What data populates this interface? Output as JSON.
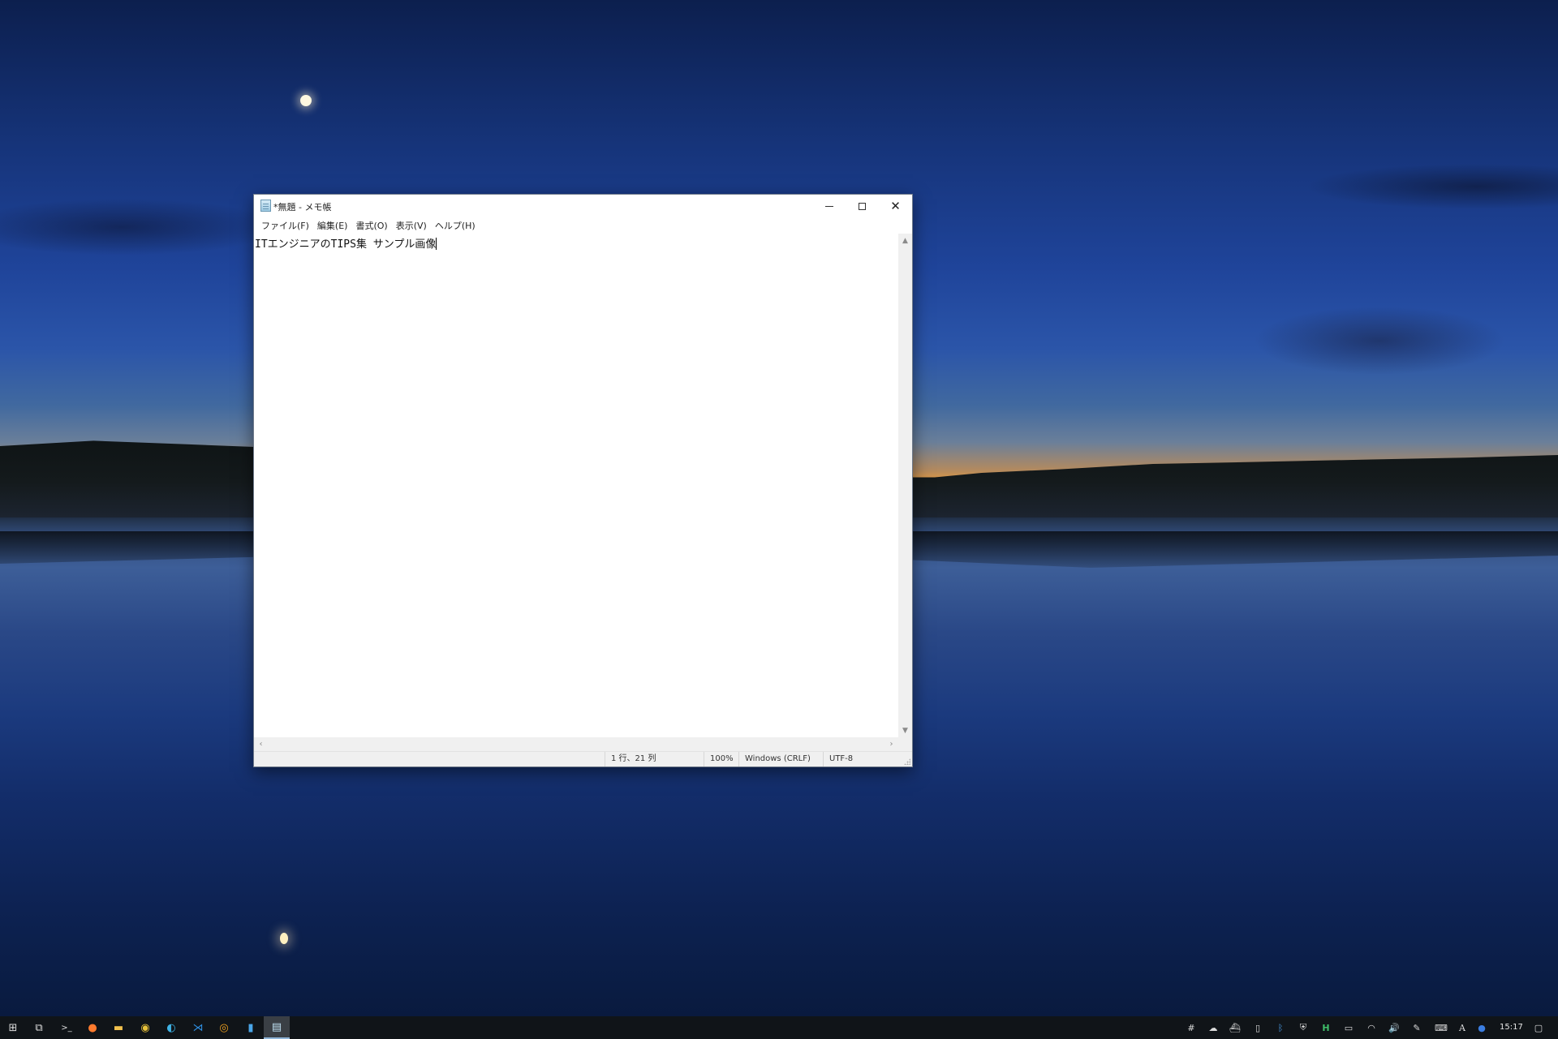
{
  "window": {
    "title": "*無題 - メモ帳",
    "close_glyph": "✕"
  },
  "menu": {
    "items": [
      {
        "label": "ファイル(F)"
      },
      {
        "label": "編集(E)"
      },
      {
        "label": "書式(O)"
      },
      {
        "label": "表示(V)"
      },
      {
        "label": "ヘルプ(H)"
      }
    ]
  },
  "editor": {
    "content": "ITエンジニアのTIPS集 サンプル画像"
  },
  "scrollbars": {
    "up_arrow": "▲",
    "down_arrow": "▼",
    "left_arrow": "‹",
    "right_arrow": "›"
  },
  "status": {
    "position": "1 行、21 列",
    "zoom": "100%",
    "line_ending": "Windows (CRLF)",
    "encoding": "UTF-8"
  },
  "taskbar": {
    "start_glyph": "⊞",
    "task_view_glyph": "⧉",
    "terminal_glyph": ">_",
    "firefox_glyph": "●",
    "explorer_glyph": "▬",
    "chrome_glyph": "◉",
    "edge_glyph": "◐",
    "vscode_glyph": "⋊",
    "app_glyph": "◎",
    "notes_glyph": "▮",
    "notepad_glyph": "▤"
  },
  "tray": {
    "icons": [
      {
        "name": "slack-icon",
        "glyph": "#"
      },
      {
        "name": "onedrive-icon",
        "glyph": "☁"
      },
      {
        "name": "docker-icon",
        "glyph": "⛴"
      },
      {
        "name": "usb-icon",
        "glyph": "▯"
      },
      {
        "name": "bluetooth-icon",
        "glyph": "ᛒ"
      },
      {
        "name": "security-icon",
        "glyph": "⛨"
      },
      {
        "name": "h-app-icon",
        "glyph": "H"
      },
      {
        "name": "battery-icon",
        "glyph": "▭"
      },
      {
        "name": "wifi-icon",
        "glyph": "◠"
      },
      {
        "name": "volume-icon",
        "glyph": "🔊"
      },
      {
        "name": "pen-icon",
        "glyph": "✎"
      },
      {
        "name": "keyboard-icon",
        "glyph": "⌨"
      },
      {
        "name": "ime-icon",
        "glyph": "A"
      },
      {
        "name": "cloud-sync-icon",
        "glyph": "●"
      }
    ],
    "clock": "15:17",
    "notification_glyph": "▢"
  },
  "colors": {
    "window_bg": "#ffffff",
    "taskbar_bg": "#101418",
    "active_indicator": "#8fb4d8"
  }
}
